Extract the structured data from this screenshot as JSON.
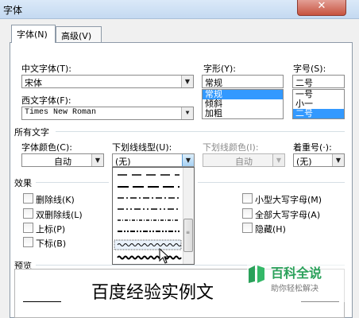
{
  "window": {
    "title": "字体",
    "close_label": "✕"
  },
  "tabs": [
    {
      "label": "字体(N)",
      "active": true
    },
    {
      "label": "高级(V)",
      "active": false
    }
  ],
  "font": {
    "chinese_font_label": "中文字体(T):",
    "chinese_font_value": "宋体",
    "western_font_label": "西文字体(F):",
    "western_font_value": "Times New Roman",
    "style_label": "字形(Y):",
    "style_value": "常规",
    "style_options": [
      "常规",
      "倾斜",
      "加粗"
    ],
    "size_label": "字号(S):",
    "size_value": "二号",
    "size_options": [
      "一号",
      "小一",
      "二号"
    ]
  },
  "all_text": {
    "section_label": "所有文字",
    "font_color_label": "字体颜色(C):",
    "font_color_value": "自动",
    "underline_type_label": "下划线线型(U):",
    "underline_type_value": "(无)",
    "underline_color_label": "下划线颜色(I):",
    "underline_color_value": "自动",
    "emphasis_label": "着重号(·):",
    "emphasis_value": "(无)"
  },
  "effects": {
    "section_label": "效果",
    "left": [
      "删除线(K)",
      "双删除线(L)",
      "上标(P)",
      "下标(B)"
    ],
    "right": [
      "小型大写字母(M)",
      "全部大写字母(A)",
      "隐藏(H)"
    ]
  },
  "preview": {
    "section_label": "预览",
    "text": "百度经验实例文"
  },
  "watermark": {
    "title": "百科全说",
    "subtitle": "助你轻松解决"
  },
  "colors": {
    "selection": "#3399ff",
    "watermark_green": "#2aa15a"
  }
}
